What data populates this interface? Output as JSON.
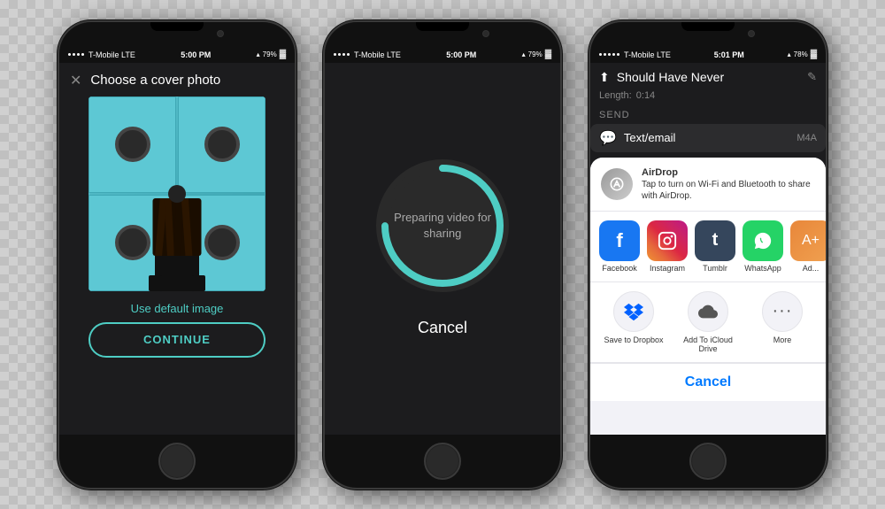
{
  "phone1": {
    "status_carrier": "T-Mobile  LTE",
    "status_time": "5:00 PM",
    "status_battery": "79%",
    "header_title": "Choose a cover photo",
    "default_image_text": "Use default image",
    "continue_label": "CONTINUE"
  },
  "phone2": {
    "status_carrier": "T-Mobile  LTE",
    "status_time": "5:00 PM",
    "status_battery": "79%",
    "preparing_text": "Preparing video for sharing",
    "cancel_label": "Cancel",
    "progress_percent": 75
  },
  "phone3": {
    "status_carrier": "T-Mobile  LTE",
    "status_time": "5:01 PM",
    "status_battery": "78%",
    "song_title": "Should Have Never",
    "length_label": "Length:",
    "length_value": "0:14",
    "send_label": "SEND",
    "text_email_label": "Text/email",
    "format_label": "M4A",
    "airdrop_title": "AirDrop",
    "airdrop_desc": "Tap to turn on Wi-Fi and Bluetooth to share with AirDrop.",
    "app_facebook": "Facebook",
    "app_instagram": "Instagram",
    "app_tumblr": "Tumblr",
    "app_whatsapp": "WhatsApp",
    "app_add": "Ad...",
    "action_dropbox": "Save to Dropbox",
    "action_icloud": "Add To iCloud Drive",
    "action_more": "More",
    "cancel_label": "Cancel"
  }
}
